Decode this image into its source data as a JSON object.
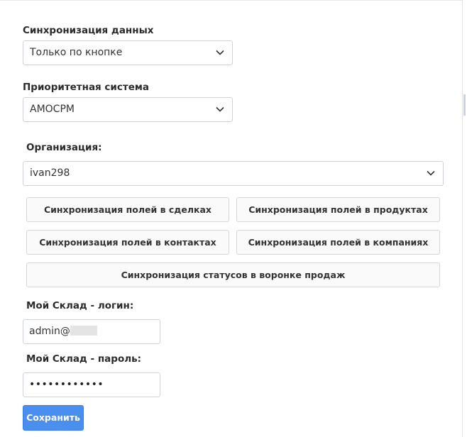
{
  "sync": {
    "label": "Синхронизация данных",
    "value": "Только по кнопке"
  },
  "priority": {
    "label": "Приоритетная система",
    "value": "АМОСРМ"
  },
  "organization": {
    "label": "Организация:",
    "value": "ivan298"
  },
  "buttons": {
    "deals": "Синхронизация полей в сделках",
    "products": "Синхронизация полей в продуктах",
    "contacts": "Синхронизация полей в контактах",
    "companies": "Синхронизация полей в компаниях",
    "statuses": "Синхронизация статусов в воронке продаж"
  },
  "login": {
    "label": "Мой Склад - логин:",
    "value": "admin@"
  },
  "password": {
    "label": "Мой Склад - пароль:",
    "value": "••••••••••••"
  },
  "save_label": "Сохранить",
  "icons": {
    "dropdown": "chevron-down-icon"
  },
  "colors": {
    "primary_button": "#4a8ef0",
    "border": "#cfd3d7"
  }
}
